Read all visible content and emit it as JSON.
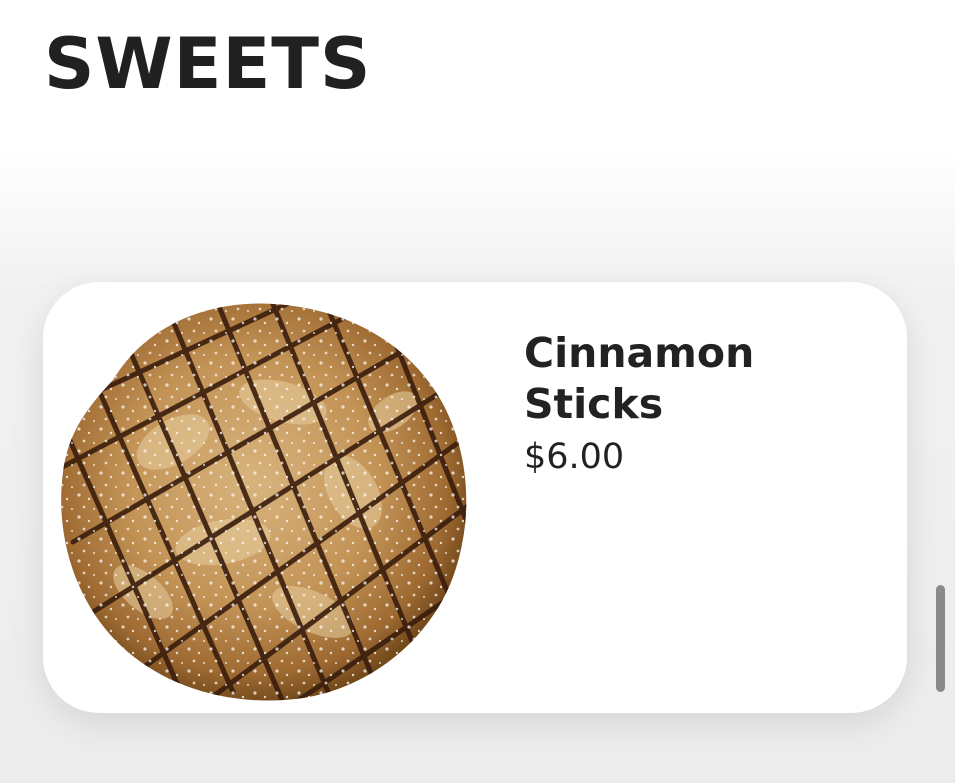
{
  "section": {
    "title": "SWEETS"
  },
  "menu_items": [
    {
      "name": "Cinnamon Sticks",
      "price": "$6.00",
      "image_icon": "cinnamon-pastry-image"
    }
  ],
  "colors": {
    "text": "#222222",
    "card_background": "#ffffff",
    "page_background": "#ffffff",
    "scrollbar": "#8a8a8a"
  }
}
